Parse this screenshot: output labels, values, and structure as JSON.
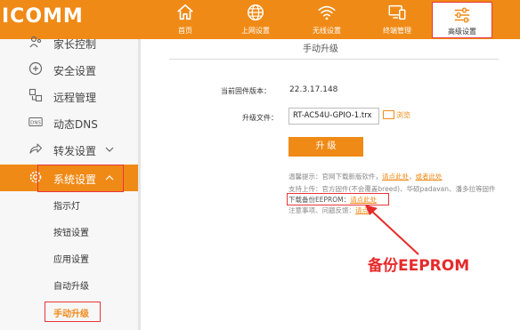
{
  "brand": {
    "logo_text": "ICOMM",
    "accent_color": "#f08a16",
    "highlight_color": "#e8353b"
  },
  "nav": {
    "items": [
      {
        "label": "首页",
        "icon": "home-icon"
      },
      {
        "label": "上网设置",
        "icon": "globe-icon"
      },
      {
        "label": "无线设置",
        "icon": "wifi-icon"
      },
      {
        "label": "终端管理",
        "icon": "devices-icon"
      },
      {
        "label": "高级设置",
        "icon": "sliders-icon",
        "active": true
      }
    ]
  },
  "sidebar": {
    "items": [
      {
        "label": "家长控制",
        "icon": "parental-control-icon"
      },
      {
        "label": "安全设置",
        "icon": "shield-icon"
      },
      {
        "label": "远程管理",
        "icon": "remote-management-icon"
      },
      {
        "label": "动态DNS",
        "icon": "dns-icon"
      },
      {
        "label": "转发设置",
        "icon": "forward-icon",
        "chevron": "v"
      },
      {
        "label": "系统设置",
        "icon": "gear-icon",
        "chevron": "^",
        "active": true
      }
    ],
    "sub_items": [
      {
        "label": "指示灯"
      },
      {
        "label": "按钮设置"
      },
      {
        "label": "应用设置"
      },
      {
        "label": "自动升级"
      },
      {
        "label": "手动升级",
        "active": true
      }
    ]
  },
  "main": {
    "title": "手动升级",
    "firmware_label": "当前固件版本：",
    "firmware_value": "22.3.17.148",
    "upgrade_file_label": "升级文件：",
    "upgrade_file_value": "RT-AC54U-GPIO-1.trx",
    "browse_label": "浏览",
    "upgrade_button": "升 级",
    "notes": [
      {
        "text": "温馨提示：官网下载新版软件，",
        "link": "请点此处",
        "sep": "，",
        "link2": "或者此处"
      },
      {
        "text": "支持上传：官方固件(不会覆盖breed)、华硕padavan、潘多拉等固件"
      },
      {
        "text": "下载备份EEPROM：",
        "link": "请点此处"
      },
      {
        "text": "注意事项、问题反馈：",
        "link": "请点"
      }
    ]
  },
  "annotation": {
    "callout_text": "备份EEPROM"
  }
}
